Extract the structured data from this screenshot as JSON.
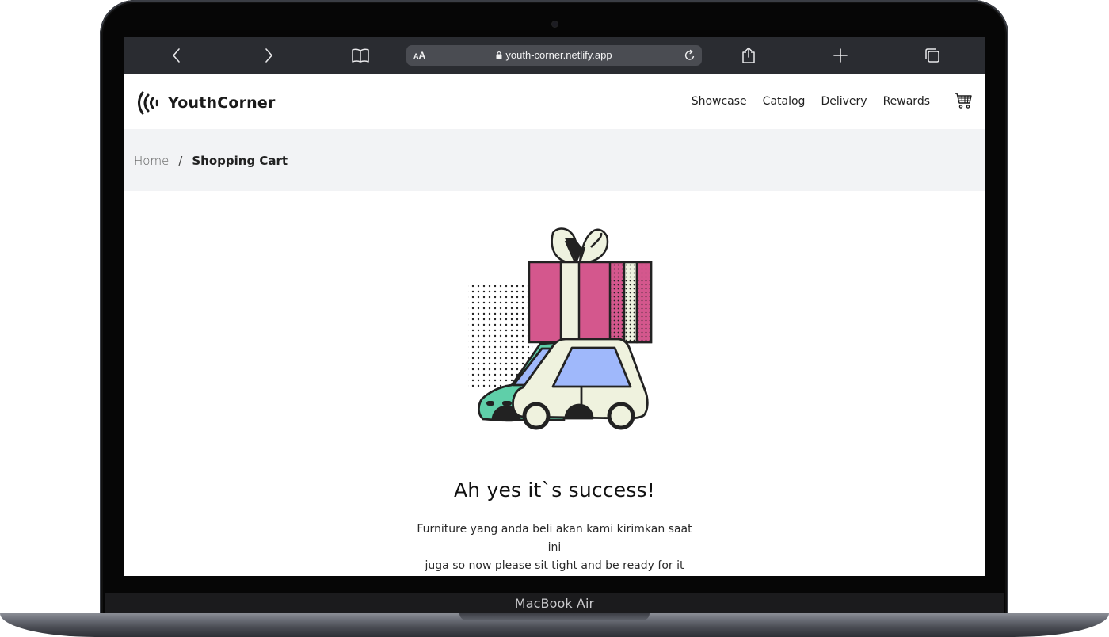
{
  "device": {
    "label": "MacBook Air"
  },
  "browser": {
    "url": "youth-corner.netlify.app",
    "reader_label": "AA"
  },
  "site": {
    "brand": "YouthCorner",
    "nav": [
      "Showcase",
      "Catalog",
      "Delivery",
      "Rewards"
    ]
  },
  "breadcrumb": {
    "home": "Home",
    "separator": "/",
    "current": "Shopping Cart"
  },
  "success": {
    "title": "Ah yes it`s success!",
    "line1": "Furniture yang anda beli akan kami kirimkan saat ini",
    "line2": "juga so now please sit tight and be ready for it"
  },
  "colors": {
    "gift_pink": "#d4578d",
    "gift_cream": "#eef2df",
    "car_cream": "#eff2de",
    "car_teal": "#5fcfa9",
    "window_blue": "#9fb8fb",
    "outline": "#222222",
    "toolbar": "#2a2c31",
    "crumb_bg": "#f2f3f5"
  }
}
